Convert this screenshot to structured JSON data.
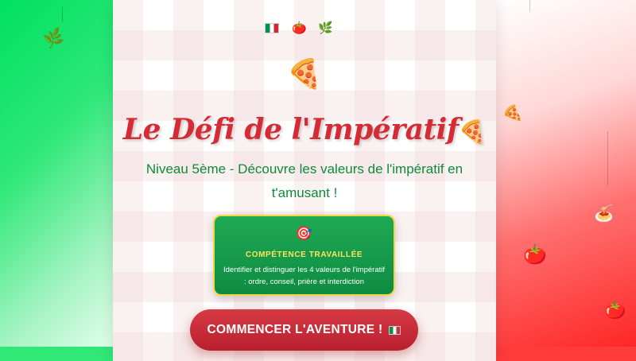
{
  "page": {
    "colors": {
      "green": "#00e060",
      "red": "#ff1f1f",
      "title_red": "#d62b34",
      "subtitle_green": "#0f8a3c",
      "box_green": "#1faa55",
      "box_border": "#f3d648",
      "button_red": "#c62a36"
    }
  },
  "decor": {
    "header_icons": [
      "italian-flag-icon",
      "tomato-icon",
      "basil-icon"
    ],
    "tomato": "🍅",
    "basil": "🌿",
    "pizza": "🍕",
    "spaghetti": "🍝"
  },
  "hero": {
    "title": "Le Défi de l'Impératif",
    "title_emoji": "🍕",
    "subtitle": "Niveau 5ème - Découvre les valeurs de l'impératif en t'amusant !"
  },
  "competence": {
    "icon": "🎯",
    "title": "COMPÉTENCE TRAVAILLÉE",
    "description": "Identifier et distinguer les 4 valeurs de l'impératif : ordre, conseil, prière et interdiction"
  },
  "cta": {
    "label": "COMMENCER L'AVENTURE !"
  }
}
